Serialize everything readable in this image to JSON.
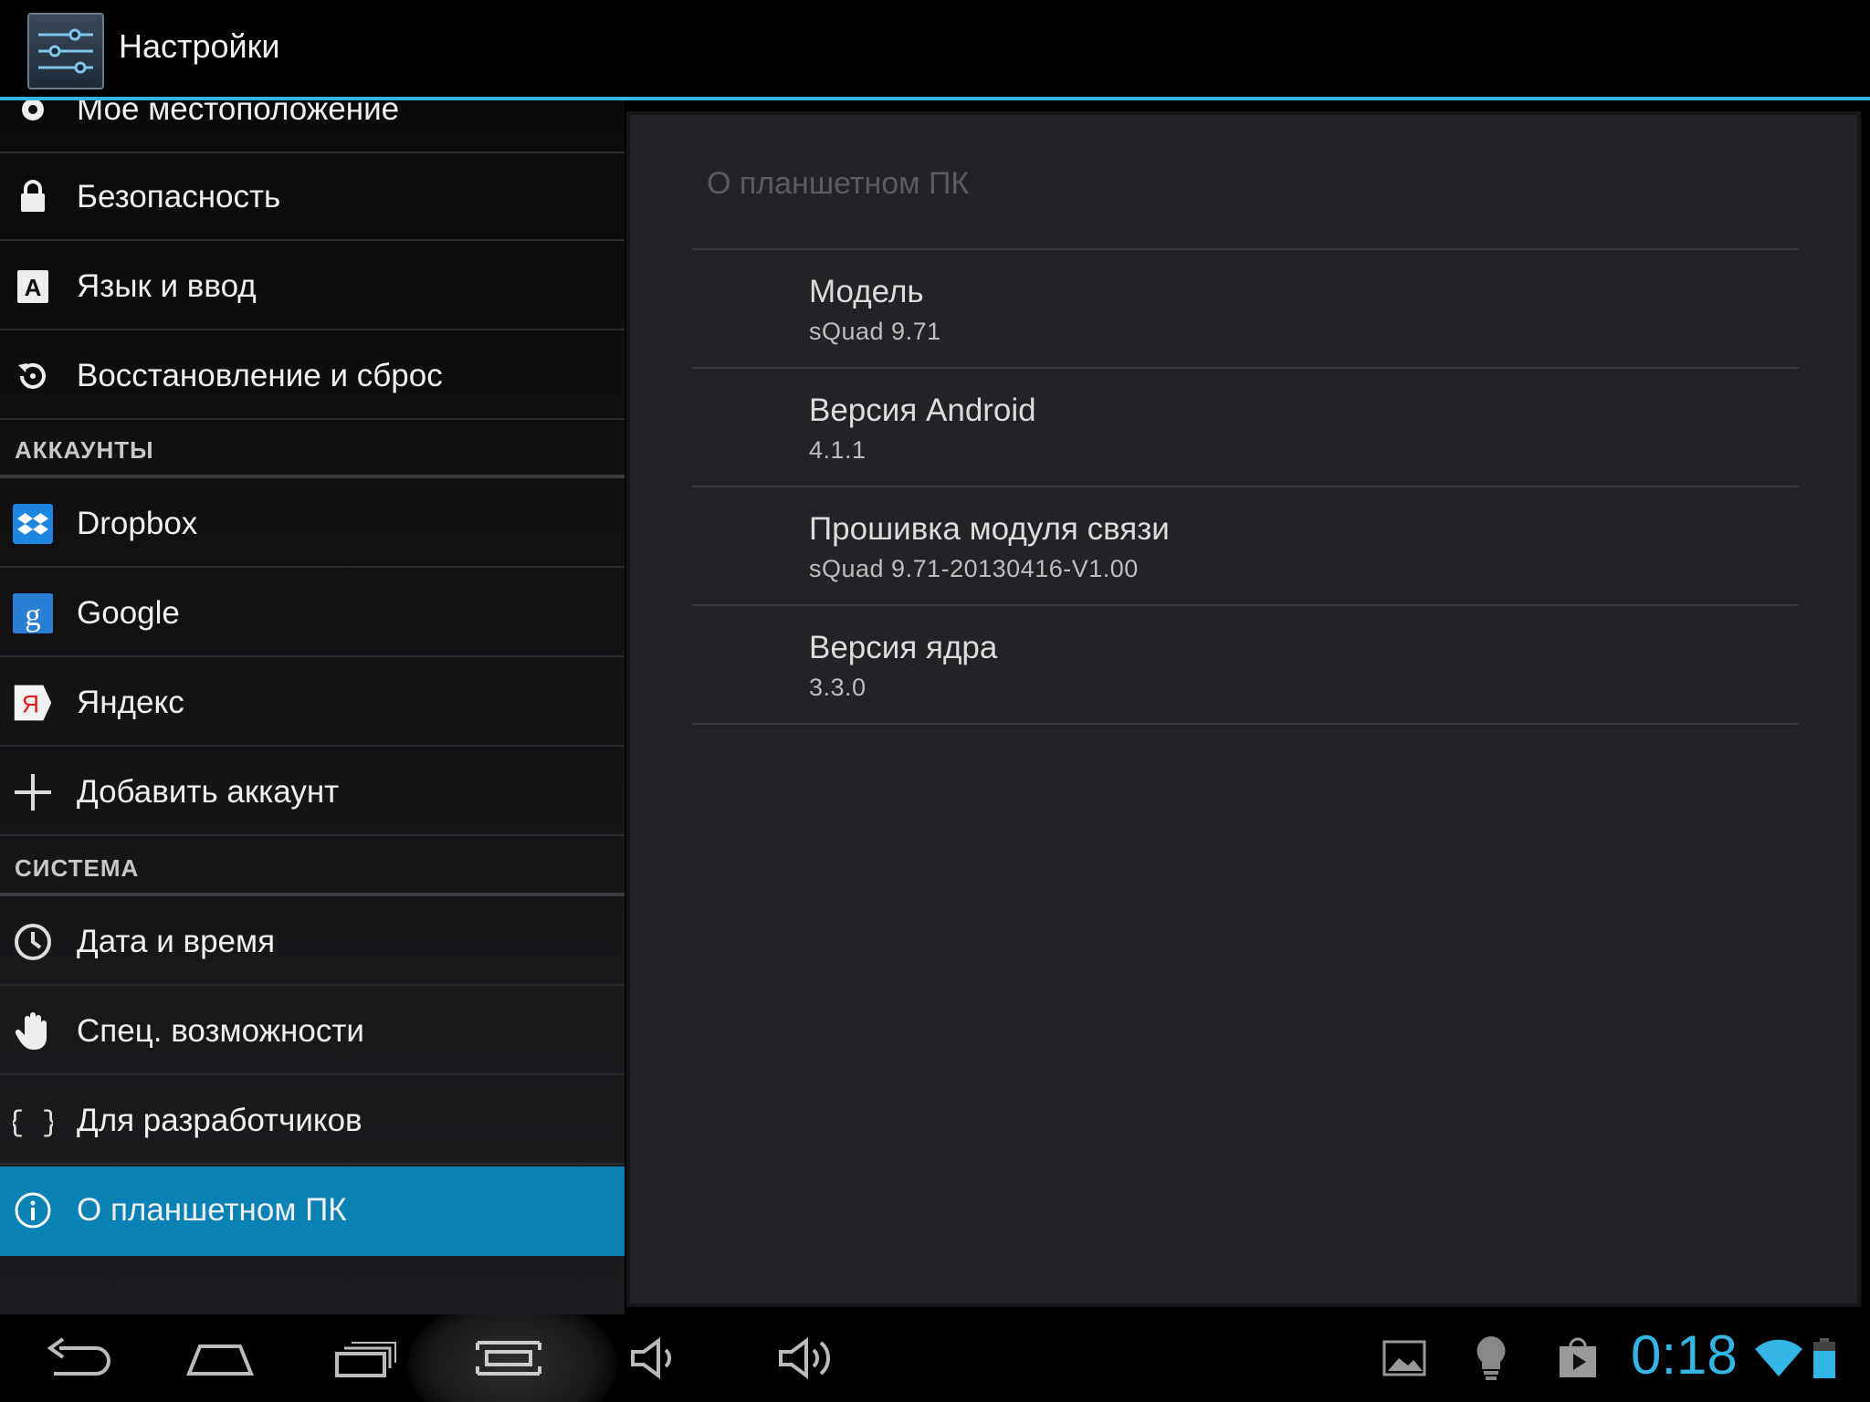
{
  "action_bar": {
    "title": "Настройки"
  },
  "sidebar": {
    "partial_item": "Мое местоположение",
    "items_top": [
      {
        "label": "Безопасность",
        "icon": "lock-icon"
      },
      {
        "label": "Язык и ввод",
        "icon": "keyboard-a-icon"
      },
      {
        "label": "Восстановление и сброс",
        "icon": "restore-icon"
      }
    ],
    "accounts_header": "АККАУНТЫ",
    "accounts": [
      {
        "label": "Dropbox",
        "icon": "dropbox-icon"
      },
      {
        "label": "Google",
        "icon": "google-icon"
      },
      {
        "label": "Яндекс",
        "icon": "yandex-icon"
      },
      {
        "label": "Добавить аккаунт",
        "icon": "plus-icon"
      }
    ],
    "system_header": "СИСТЕМА",
    "system": [
      {
        "label": "Дата и время",
        "icon": "clock-icon"
      },
      {
        "label": "Спец. возможности",
        "icon": "hand-icon"
      },
      {
        "label": "Для разработчиков",
        "icon": "braces-icon"
      },
      {
        "label": "О планшетном ПК",
        "icon": "info-icon",
        "selected": true
      }
    ]
  },
  "detail": {
    "title": "О планшетном ПК",
    "items": [
      {
        "title": "Модель",
        "value": "sQuad 9.71"
      },
      {
        "title": "Версия Android",
        "value": "4.1.1"
      },
      {
        "title": "Прошивка модуля связи",
        "value": "sQuad 9.71-20130416-V1.00"
      },
      {
        "title": "Версия ядра",
        "value": "3.3.0"
      }
    ]
  },
  "status_bar": {
    "clock": "0:18"
  },
  "colors": {
    "accent": "#33b5e5",
    "selected": "#0882b4"
  }
}
